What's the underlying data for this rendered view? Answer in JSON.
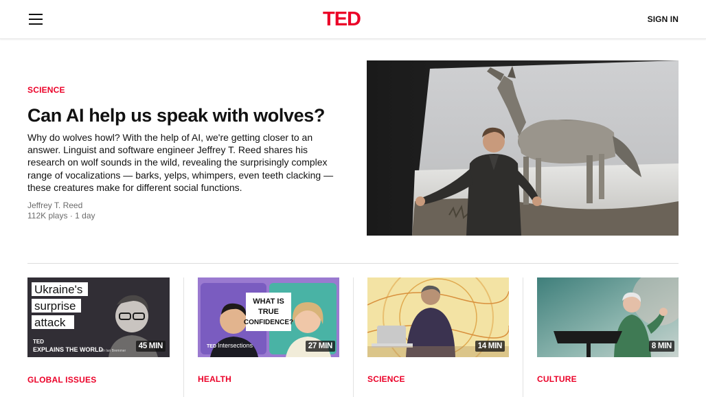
{
  "header": {
    "logo": "TED",
    "sign_in": "SIGN IN"
  },
  "hero": {
    "category": "SCIENCE",
    "title": "Can AI help us speak with wolves?",
    "description": "Why do wolves howl? With the help of AI, we're getting closer to an answer. Linguist and software engineer Jeffrey T. Reed shares his research on wolf sounds in the wild, revealing the surprisingly complex range of vocalizations — barks, yelps, whimpers, even teeth clacking — these creatures make for different social functions.",
    "speaker": "Jeffrey T. Reed",
    "meta": "112K plays · 1 day"
  },
  "cards": [
    {
      "category": "GLOBAL ISSUES",
      "duration": "45 MIN",
      "thumb_text": [
        "Ukraine's",
        "surprise",
        "attack"
      ],
      "thumb_brand": "TED",
      "thumb_series": "EXPLAINS THE WORLD",
      "thumb_host": "with Ian Bremmer"
    },
    {
      "category": "HEALTH",
      "duration": "27 MIN",
      "thumb_text": [
        "WHAT IS",
        "TRUE",
        "CONFIDENCE?"
      ],
      "thumb_brand": "TED",
      "thumb_series": "Intersections"
    },
    {
      "category": "SCIENCE",
      "duration": "14 MIN"
    },
    {
      "category": "CULTURE",
      "duration": "8 MIN"
    }
  ],
  "colors": {
    "brand_red": "#eb0028",
    "text": "#111111",
    "muted": "#6b6b6b"
  },
  "icons": {
    "menu": "hamburger-menu-icon"
  }
}
